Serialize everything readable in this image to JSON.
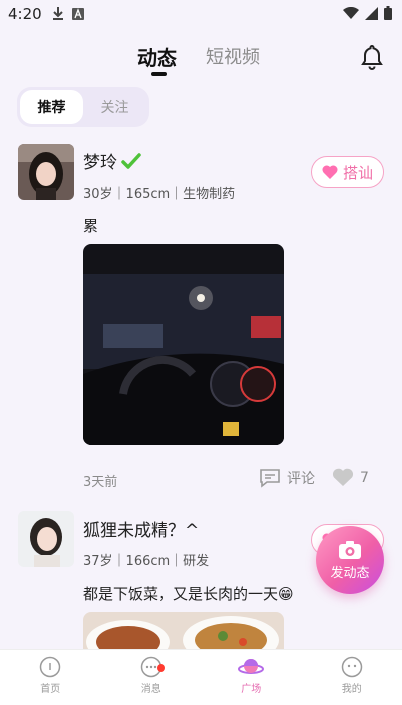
{
  "status_bar": {
    "time": "4:20",
    "icons": [
      "download-icon",
      "a-badge-icon",
      "wifi-icon",
      "signal-icon",
      "battery-icon"
    ]
  },
  "top_nav": {
    "tabs": [
      {
        "label": "动态",
        "active": true
      },
      {
        "label": "短视频",
        "active": false
      }
    ],
    "bell_icon": "bell-icon"
  },
  "segment": {
    "options": [
      {
        "label": "推荐",
        "active": true
      },
      {
        "label": "关注",
        "active": false
      }
    ]
  },
  "posts": [
    {
      "name": "梦玲",
      "verified_icon": "check-mark-icon",
      "meta": "30岁｜165cm｜生物制药",
      "greet_label": "搭讪",
      "text": "累",
      "time": "3天前",
      "comment_label": "评论",
      "likes": "7"
    },
    {
      "name": "狐狸未成精？^",
      "meta": "37岁｜166cm｜研发",
      "greet_label": "搭讪",
      "text": "都是下饭菜，又是长肉的一天😁"
    }
  ],
  "fab": {
    "label": "发动态",
    "icon": "camera-icon"
  },
  "bottom_nav": {
    "items": [
      {
        "label": "首页",
        "active": false
      },
      {
        "label": "消息",
        "active": false,
        "badge": true
      },
      {
        "label": "广场",
        "active": true
      },
      {
        "label": "我的",
        "active": false
      }
    ]
  },
  "colors": {
    "accent_pink": "#f06ea7",
    "background": "#f6f3fb"
  }
}
